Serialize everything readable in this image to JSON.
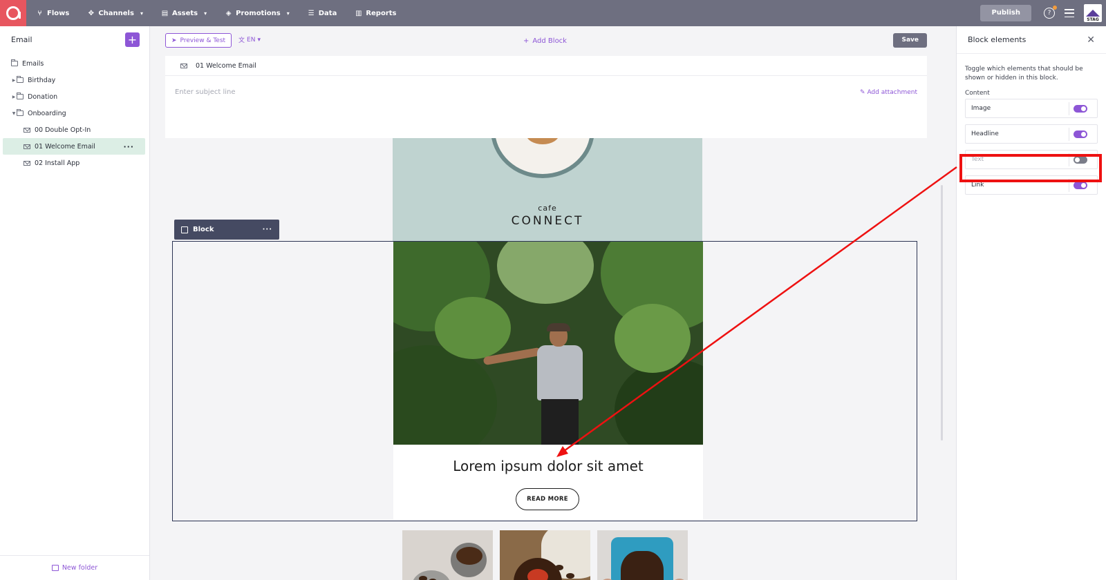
{
  "topbar": {
    "nav": [
      {
        "label": "Flows",
        "icon": "flows-icon"
      },
      {
        "label": "Channels",
        "icon": "channels-icon",
        "dropdown": true
      },
      {
        "label": "Assets",
        "icon": "assets-icon",
        "dropdown": true
      },
      {
        "label": "Promotions",
        "icon": "promotions-icon",
        "dropdown": true
      },
      {
        "label": "Data",
        "icon": "data-icon"
      },
      {
        "label": "Reports",
        "icon": "reports-icon"
      }
    ],
    "publish_label": "Publish",
    "avatar_label": "STAG"
  },
  "sidebar": {
    "title": "Email",
    "tree": {
      "root": "Emails",
      "birthday": "Birthday",
      "donation": "Donation",
      "onboarding": "Onboarding",
      "item_0": "00 Double Opt-In",
      "item_1": "01 Welcome Email",
      "item_2": "02 Install App"
    },
    "new_folder_label": "New folder"
  },
  "editor": {
    "preview_label": "Preview & Test",
    "language": "EN",
    "add_block_label": "Add Block",
    "save_label": "Save",
    "email_tab": "01 Welcome Email",
    "subject_placeholder": "Enter subject line",
    "attachment_label": "Add attachment",
    "brand_small": "cafe",
    "brand_big": "CONNECT",
    "block_label": "Block",
    "headline": "Lorem ipsum dolor sit amet",
    "read_more": "READ MORE"
  },
  "panel": {
    "title": "Block elements",
    "description": "Toggle which elements that should be shown or hidden in this block.",
    "section": "Content",
    "toggles": {
      "image": {
        "label": "Image",
        "on": true
      },
      "headline": {
        "label": "Headline",
        "on": true
      },
      "text": {
        "label": "Text",
        "on": false
      },
      "link": {
        "label": "Link",
        "on": true
      }
    }
  },
  "colors": {
    "topbar": "#6e6f80",
    "accent": "#8d56d6",
    "logo": "#e7565f",
    "annotation": "#ee1111"
  }
}
